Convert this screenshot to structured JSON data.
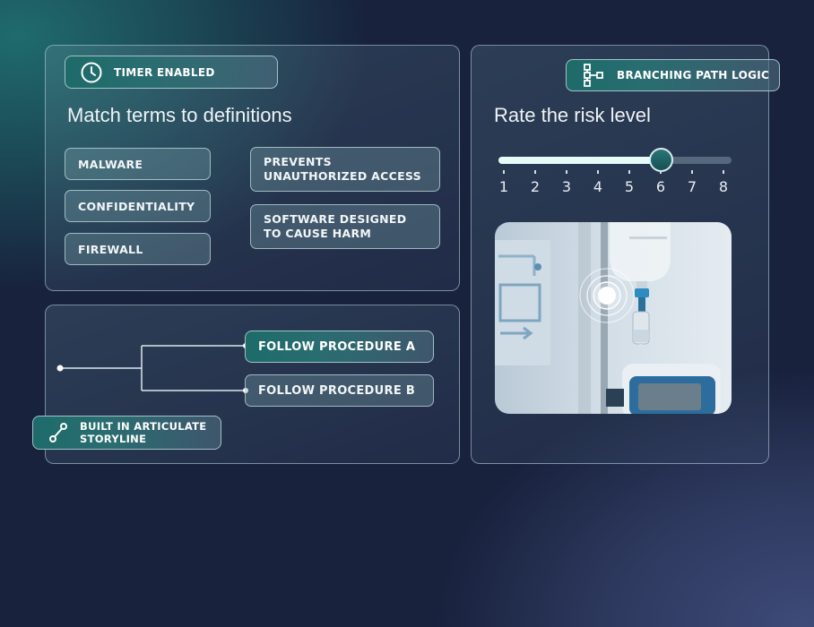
{
  "matching_card": {
    "badge_label": "TIMER ENABLED",
    "badge_icon": "clock-icon",
    "title": "Match terms to definitions",
    "terms": [
      "MALWARE",
      "CONFIDENTIALITY",
      "FIREWALL"
    ],
    "definitions": [
      "PREVENTS UNAUTHORIZED ACCESS",
      "SOFTWARE DESIGNED TO CAUSE HARM"
    ]
  },
  "branching_card": {
    "options": [
      "FOLLOW PROCEDURE A",
      "FOLLOW PROCEDURE B"
    ],
    "built_badge_label": "BUILT IN ARTICULATE STORYLINE",
    "built_badge_icon": "path-node-icon"
  },
  "risk_card": {
    "badge_label": "BRANCHING PATH LOGIC",
    "badge_icon": "branching-tree-icon",
    "title": "Rate the risk level",
    "scale": [
      "1",
      "2",
      "3",
      "4",
      "5",
      "6",
      "7",
      "8"
    ],
    "selected_value": 6,
    "image_alt": "iv-drip-medical-scene",
    "hotspot_icon": "hotspot-pulse-icon"
  },
  "colors": {
    "accent_teal": "#1d6b6a",
    "background": "#18223d",
    "slider_fill": "#e6fbf8"
  }
}
